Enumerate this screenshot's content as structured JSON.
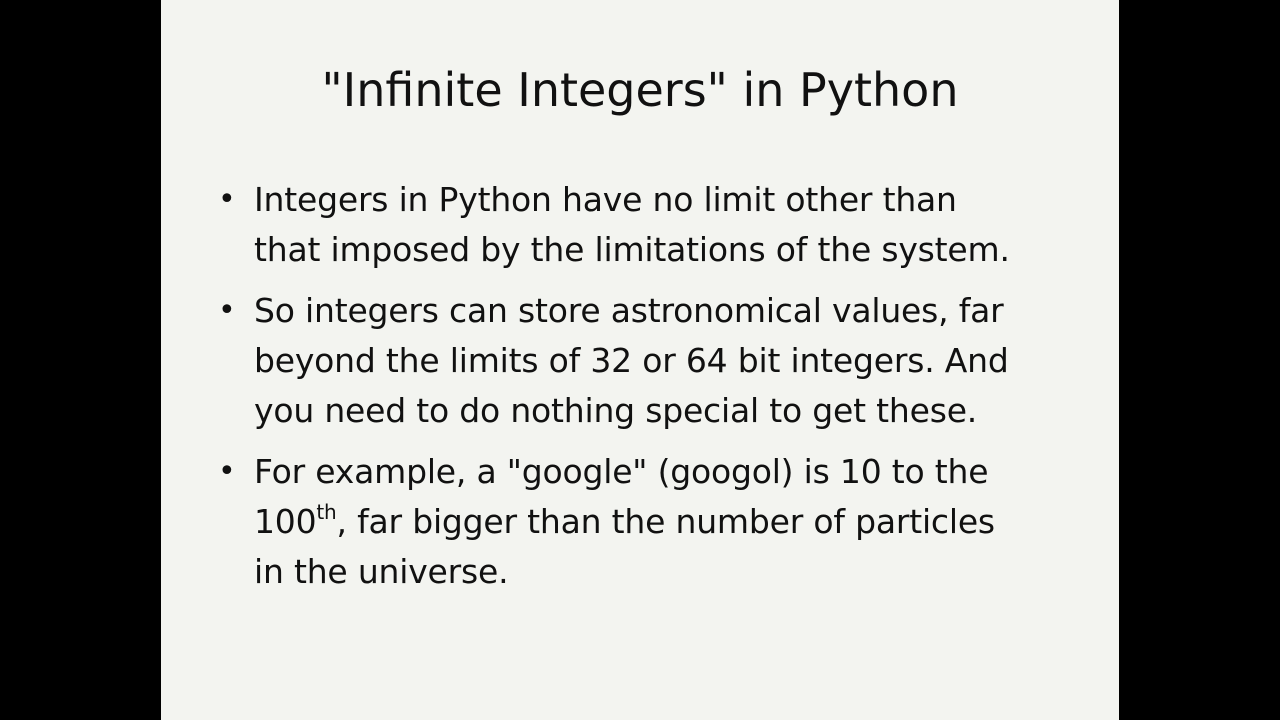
{
  "slide": {
    "title": "\"Infinite Integers\" in Python",
    "bullet_symbol": "•",
    "bullets": [
      {
        "lines": [
          "Integers in Python have no limit other than",
          "that imposed by the limitations of the system."
        ]
      },
      {
        "lines": [
          "So integers can store astronomical values, far",
          "beyond the limits of 32 or 64 bit integers. And",
          "you need to do nothing special to get these."
        ]
      },
      {
        "line1": "For example, a \"google\" (googol) is 10 to the",
        "line2_base": "100",
        "line2_sup": "th",
        "line2_rest": ", far bigger than the number of particles",
        "line3": "in the universe."
      }
    ]
  }
}
